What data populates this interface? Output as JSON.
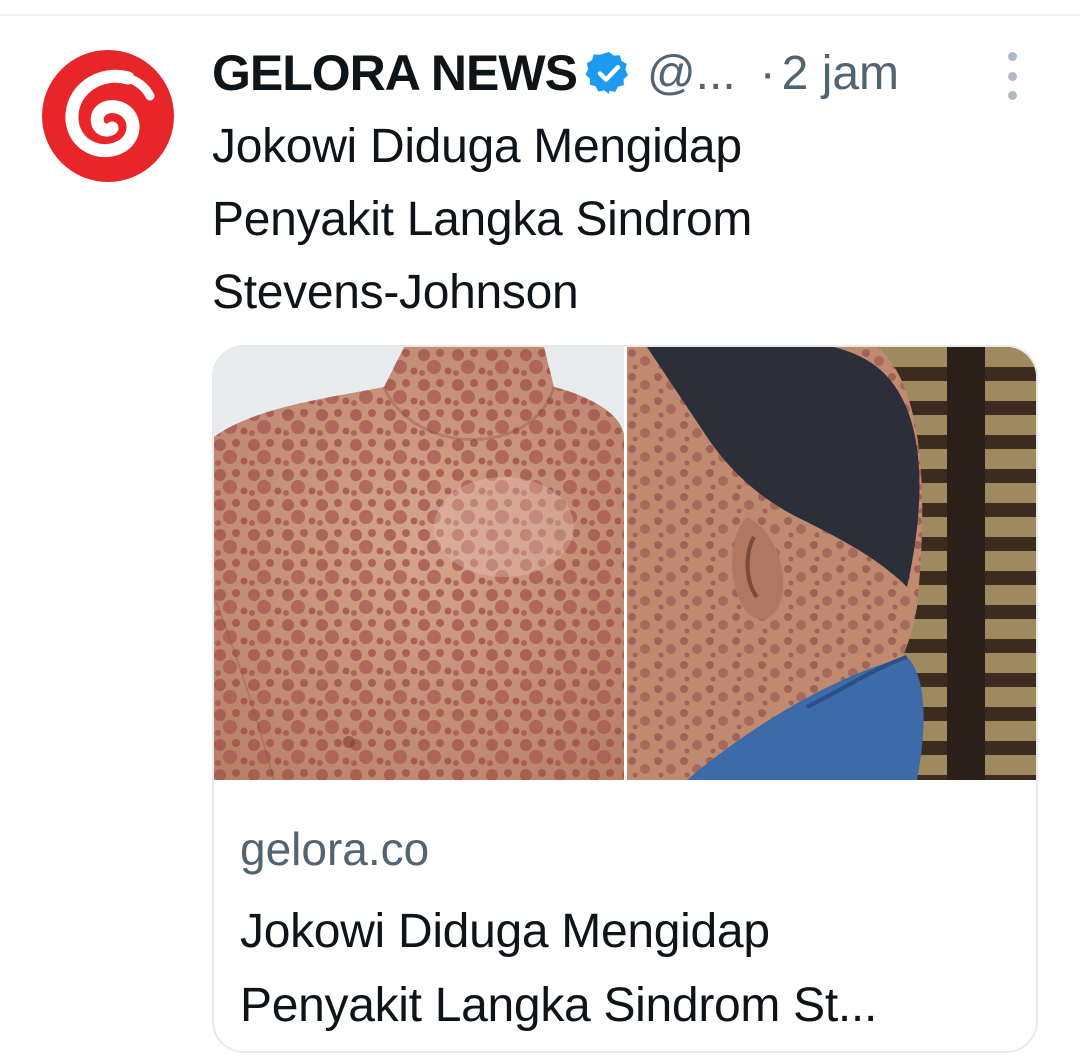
{
  "tweet": {
    "author": {
      "display_name": "GELORA NEWS",
      "handle": "@...",
      "verified_icon": "verified-badge-icon",
      "avatar_logo": "gelora-swirl-logo",
      "brand_color": "#e8262a"
    },
    "separator": "·",
    "timestamp": "2 jam",
    "more_icon": "more-vertical-icon",
    "text_lines": [
      "Jokowi Diduga Mengidap",
      "Penyakit Langka Sindrom",
      "Stevens-Johnson"
    ],
    "card": {
      "images": [
        {
          "name": "rash-chest-photo"
        },
        {
          "name": "man-side-profile-photo"
        }
      ],
      "domain": "gelora.co",
      "title_lines": [
        "Jokowi Diduga Mengidap",
        "Penyakit Langka Sindrom St..."
      ]
    }
  },
  "colors": {
    "primary_text": "#0f1419",
    "secondary_text": "#536471",
    "verified_blue": "#1d9bf0",
    "border": "#e7e9ea"
  }
}
